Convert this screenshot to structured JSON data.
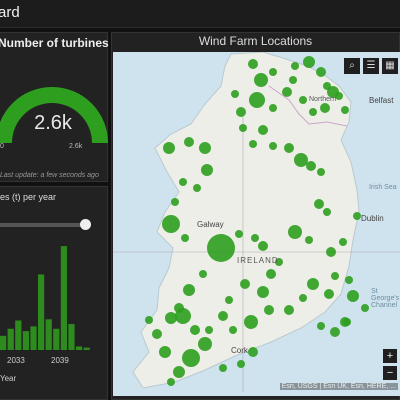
{
  "header": {
    "title": "ard"
  },
  "turbines": {
    "title": "Number of turbines",
    "value": "2.6k",
    "min_label": "0",
    "max_label": "2.6k",
    "progress": 1.0,
    "last_update": "Last update: a few seconds ago"
  },
  "histogram": {
    "title": "es (t) per year",
    "x_label": "Year",
    "x_ticks": [
      "2033",
      "2039"
    ]
  },
  "map": {
    "title": "Wind Farm Locations",
    "attribution": "Esri, USGS | Esri UK, Esri, HERE, ...",
    "labels": {
      "northern": "Northern",
      "belfast": "Belfast",
      "dublin": "Dublin",
      "galway": "Galway",
      "ireland": "IRELAND",
      "cork": "Cork",
      "irish_sea": "Irish Sea",
      "st_george": "St George's Channel"
    },
    "tools": [
      "search-icon",
      "list-icon",
      "grid-icon"
    ],
    "colors": {
      "water": "#cfe3ee",
      "land": "#eeeee9",
      "marker": "#2e9e1f"
    }
  },
  "colors": {
    "accent": "#2e9e1f",
    "bar": "#2e8b1e"
  },
  "chart_data": {
    "type": "bar",
    "x_ticks": [
      "2033",
      "2039"
    ],
    "xlabel": "Year",
    "values": [
      12,
      18,
      25,
      16,
      20,
      64,
      26,
      18,
      88,
      22,
      3,
      2
    ]
  }
}
